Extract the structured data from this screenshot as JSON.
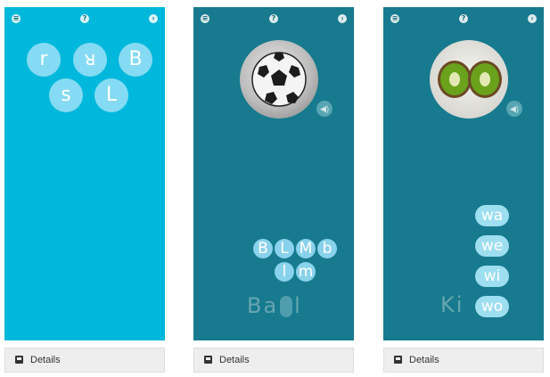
{
  "colors": {
    "screen1_bg": "#00b8db",
    "screen23_bg": "#177a8e",
    "bubble": "#aae6fa",
    "details_bg": "#eeeeee"
  },
  "icons": {
    "top_left": "menu-icon",
    "top_mid": "help-icon",
    "top_right": "next-icon",
    "sound": "speaker-icon",
    "details": "details-icon"
  },
  "screen1": {
    "help_glyph": "?",
    "letters": [
      "r",
      "ᴚ",
      "B",
      "s",
      "L"
    ]
  },
  "screen2": {
    "help_glyph": "?",
    "image": "soccer-ball",
    "choices": [
      "B",
      "L",
      "M",
      "b",
      "l",
      "m"
    ],
    "word_prefix": "Ba",
    "word_suffix": "l"
  },
  "screen3": {
    "help_glyph": "?",
    "image": "kiwi-fruit",
    "choices": [
      "wa",
      "we",
      "wi",
      "wo"
    ],
    "word_prefix": "Ki"
  },
  "details_label": "Details"
}
